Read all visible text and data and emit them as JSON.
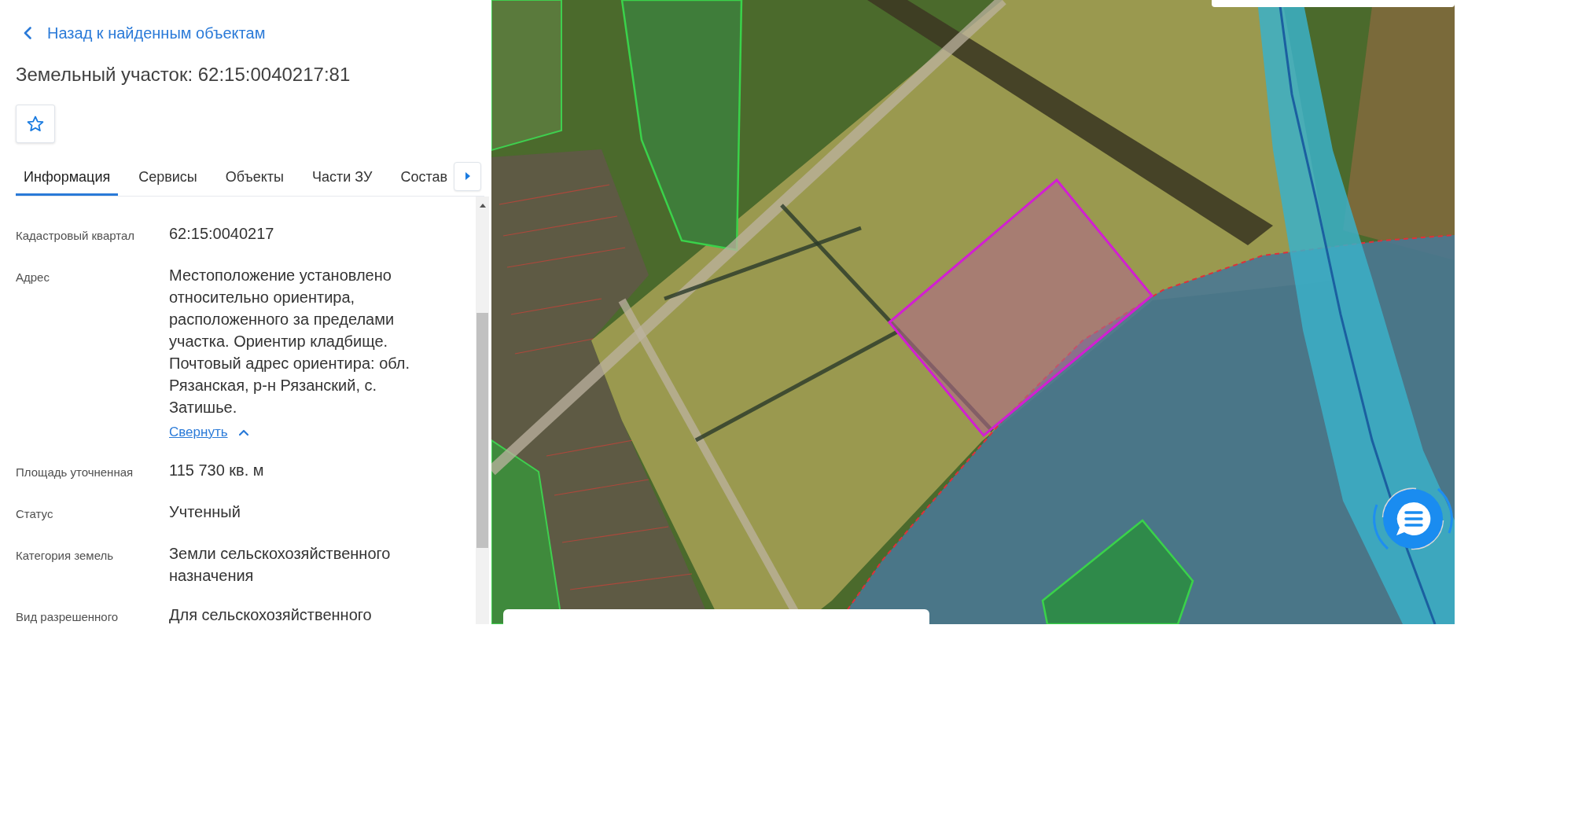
{
  "back_link": {
    "label": "Назад к найденным объектам"
  },
  "title": "Земельный участок: 62:15:0040217:81",
  "favorite": {
    "on": false
  },
  "tabs": [
    {
      "label": "Информация",
      "selected": true
    },
    {
      "label": "Сервисы",
      "selected": false
    },
    {
      "label": "Объекты",
      "selected": false
    },
    {
      "label": "Части ЗУ",
      "selected": false
    },
    {
      "label": "Состав",
      "selected": false
    }
  ],
  "properties": [
    {
      "label": "Кадастровый квартал",
      "value": "62:15:0040217"
    },
    {
      "label": "Адрес",
      "value": "Местоположение установлено относительно ориентира, расположенного за пределами участка. Ориентир кладбище. Почтовый адрес ориентира: обл. Рязанская, р-н Рязанский, с. Затишье.",
      "toggle": {
        "label": "Свернуть",
        "expanded": true
      }
    },
    {
      "label": "Площадь уточненная",
      "value": "115 730 кв. м"
    },
    {
      "label": "Статус",
      "value": "Учтенный"
    },
    {
      "label": "Категория земель",
      "value": "Земли сельскохозяйственного назначения"
    },
    {
      "label": "Вид разрешенного",
      "value": "Для сельскохозяйственного"
    }
  ]
}
